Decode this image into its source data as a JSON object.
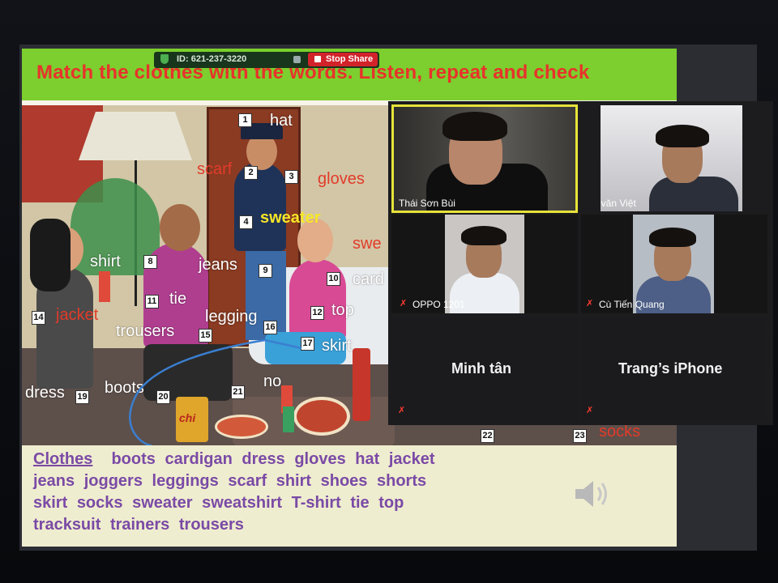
{
  "zoom": {
    "meeting_id": "ID: 621-237-3220",
    "stop_share": "Stop Share"
  },
  "slide": {
    "title": "Match the clothes with the words. Listen, repeat and check",
    "labels": {
      "hat": "hat",
      "scarf": "scarf",
      "gloves": "gloves",
      "sweater": "sweater",
      "swe": "swe",
      "shirt": "shirt",
      "jeans": "jeans",
      "cardigan": "card",
      "jacket": "jacket",
      "tie": "tie",
      "leggings": "legging",
      "top": "top",
      "trousers": "trousers",
      "skirt": "skirt",
      "dress": "dress",
      "boots": "boots",
      "shoes_partial": "no",
      "socks": "socks"
    },
    "numbers": [
      "1",
      "2",
      "3",
      "4",
      "8",
      "9",
      "10",
      "11",
      "12",
      "14",
      "15",
      "16",
      "17",
      "19",
      "20",
      "21",
      "22",
      "23"
    ],
    "chips_label": "chi",
    "word_bank": {
      "heading": "Clothes",
      "line1": [
        "boots",
        "cardigan",
        "dress",
        "gloves",
        "hat",
        "jacket"
      ],
      "line2": [
        "jeans",
        "joggers",
        "leggings",
        "scarf",
        "shirt",
        "shoes",
        "shorts"
      ],
      "line3": [
        "skirt",
        "socks",
        "sweater",
        "sweatshirt",
        "T-shirt",
        "tie",
        "top"
      ],
      "line4": [
        "tracksuit",
        "trainers",
        "trousers"
      ]
    }
  },
  "participants": [
    {
      "name": "Thái Sơn Bùi",
      "active_speaker": true,
      "muted": false
    },
    {
      "name": "Đỗ văn Việt",
      "active_speaker": false,
      "muted": false
    },
    {
      "name": "OPPO 1201",
      "active_speaker": false,
      "muted": true
    },
    {
      "name": "Cù Tiến Quang",
      "active_speaker": false,
      "muted": true
    },
    {
      "name": "Minh tân",
      "active_speaker": false,
      "muted": true
    },
    {
      "name": "Trang’s iPhone",
      "active_speaker": false,
      "muted": true
    }
  ],
  "colors": {
    "title_bar": "#7ccf2e",
    "title_text": "#e8322b",
    "word_bank_text": "#7a4aa6",
    "active_speaker_border": "#e6e23a",
    "stop_share": "#d2232a"
  }
}
